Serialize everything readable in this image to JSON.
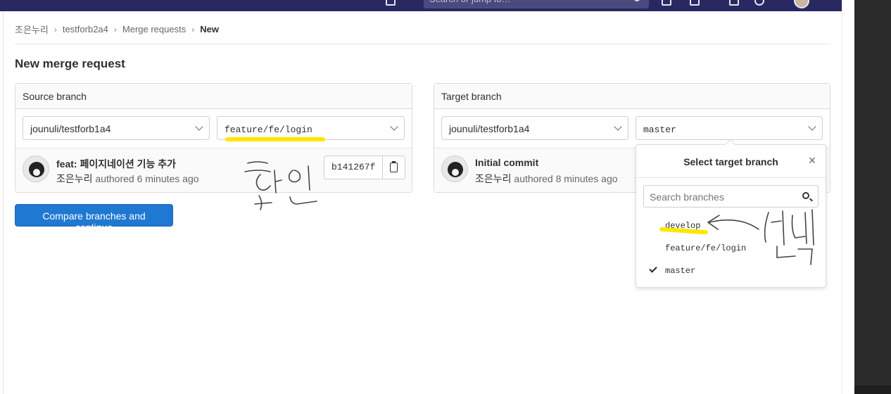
{
  "topbar": {
    "search_placeholder": "Search or jump to…"
  },
  "breadcrumb": {
    "items": [
      "조은누리",
      "testforb2a4",
      "Merge requests"
    ],
    "current": "New"
  },
  "page": {
    "title": "New merge request"
  },
  "source": {
    "header": "Source branch",
    "project": "jounuli/testforb1a4",
    "branch": "feature/fe/login",
    "commit": {
      "title": "feat: 페이지네이션 기능 추가",
      "author": "조은누리",
      "meta": "authored 6 minutes ago",
      "sha": "b141267f"
    }
  },
  "target": {
    "header": "Target branch",
    "project": "jounuli/testforb1a4",
    "branch": "master",
    "commit": {
      "title": "Initial commit",
      "author": "조은누리",
      "meta": "authored 8 minutes ago"
    }
  },
  "compare_button": "Compare branches and continue",
  "target_dropdown": {
    "title": "Select target branch",
    "search_placeholder": "Search branches",
    "options": [
      "develop",
      "feature/fe/login",
      "master"
    ],
    "selected": "master"
  },
  "colors": {
    "topbar": "#292961",
    "primary": "#1f78d1",
    "highlight": "#ffe600"
  }
}
